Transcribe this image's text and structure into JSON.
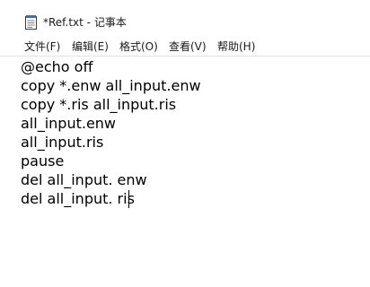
{
  "window": {
    "title": "*Ref.txt - 记事本"
  },
  "menu": {
    "items": [
      {
        "label": "文件(F)"
      },
      {
        "label": "编辑(E)"
      },
      {
        "label": "格式(O)"
      },
      {
        "label": "查看(V)"
      },
      {
        "label": "帮助(H)"
      }
    ]
  },
  "editor": {
    "lines": [
      "@echo off",
      "copy *.enw all_input.enw",
      "copy *.ris all_input.ris",
      "all_input.enw",
      "all_input.ris",
      "pause",
      "del all_input. enw",
      "del all_input. ris"
    ]
  },
  "icons": {
    "app": "notepad-icon"
  }
}
